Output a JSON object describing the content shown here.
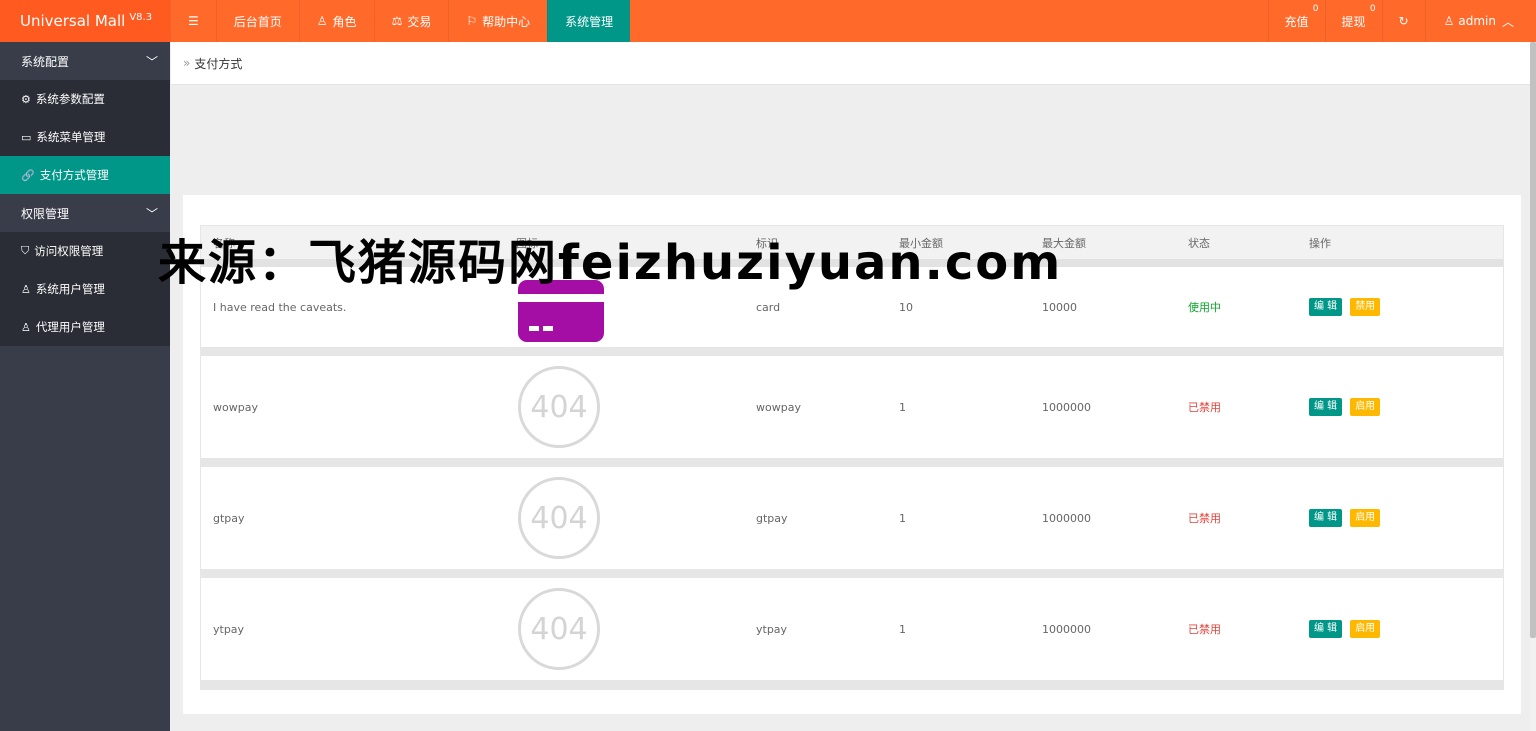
{
  "app": {
    "name": "Universal Mall",
    "version": "V8.3"
  },
  "topnav": {
    "menu_icon": "☰",
    "items": [
      {
        "label": "后台首页",
        "icon": ""
      },
      {
        "label": "角色",
        "icon": "user-icon"
      },
      {
        "label": "交易",
        "icon": "scale-icon"
      },
      {
        "label": "帮助中心",
        "icon": "flag-icon"
      },
      {
        "label": "系统管理",
        "icon": "",
        "active": true
      }
    ]
  },
  "topright": {
    "recharge": "充值",
    "recharge_count": "0",
    "withdraw": "提现",
    "withdraw_count": "0",
    "refresh_icon": "↻",
    "user": "admin"
  },
  "sidebar": {
    "group1": "系统配置",
    "items1": [
      {
        "label": "系统参数配置",
        "icon": "gear-icon"
      },
      {
        "label": "系统菜单管理",
        "icon": "window-icon"
      },
      {
        "label": "支付方式管理",
        "icon": "link-icon",
        "active": true
      }
    ],
    "group2": "权限管理",
    "items2": [
      {
        "label": "访问权限管理",
        "icon": "shield-icon"
      },
      {
        "label": "系统用户管理",
        "icon": "user-icon"
      },
      {
        "label": "代理用户管理",
        "icon": "users-icon"
      }
    ]
  },
  "breadcrumb": {
    "icon": "»",
    "current": "支付方式"
  },
  "table": {
    "headers": [
      "名称",
      "图标",
      "标识",
      "最小金额",
      "最大金额",
      "状态",
      "操作"
    ],
    "edit_label": "编 辑",
    "icon_404": "404",
    "rows": [
      {
        "name": "I have read the caveats.",
        "icon": "card",
        "code": "card",
        "min": "10",
        "max": "10000",
        "status": "使用中",
        "status_type": "on",
        "toggle": "禁用"
      },
      {
        "name": "wowpay",
        "icon": "404",
        "code": "wowpay",
        "min": "1",
        "max": "1000000",
        "status": "已禁用",
        "status_type": "off",
        "toggle": "启用"
      },
      {
        "name": "gtpay",
        "icon": "404",
        "code": "gtpay",
        "min": "1",
        "max": "1000000",
        "status": "已禁用",
        "status_type": "off",
        "toggle": "启用"
      },
      {
        "name": "ytpay",
        "icon": "404",
        "code": "ytpay",
        "min": "1",
        "max": "1000000",
        "status": "已禁用",
        "status_type": "off",
        "toggle": "启用"
      }
    ]
  },
  "colors": {
    "header": "#ff6a2b",
    "accent": "#009688",
    "warn": "#ffb800",
    "card_icon": "#a50ea5"
  },
  "watermark": "来源：飞猪源码网feizhuziyuan.com"
}
